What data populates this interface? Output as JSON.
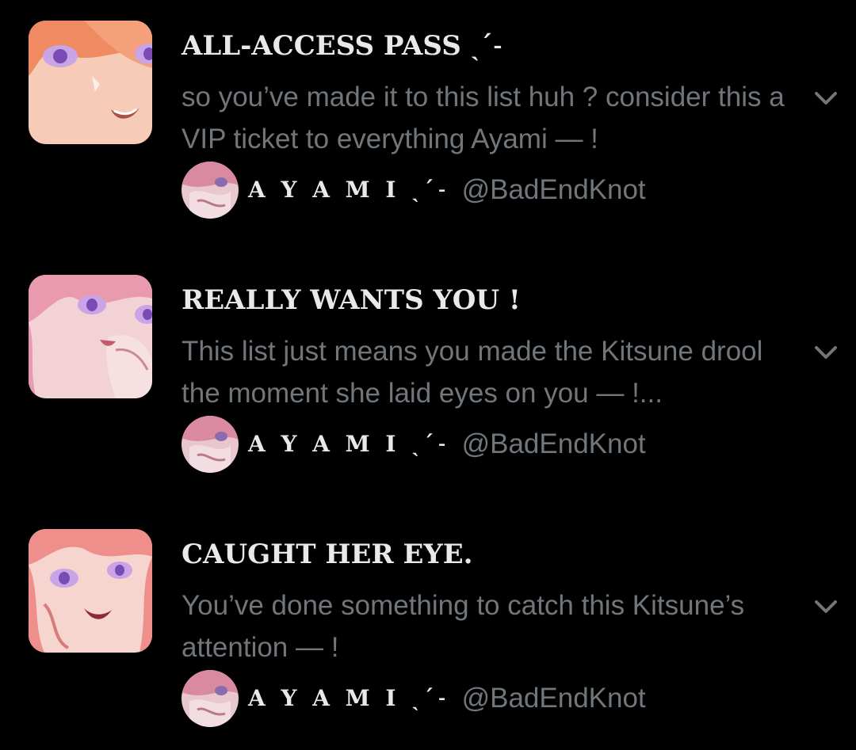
{
  "lists": [
    {
      "title": "ALL-ACCESS PASS ˎˊ˗",
      "description": "so you’ve made it to this list huh ? consider this a VIP ticket to everything Ayami — !",
      "owner_name": "A Y A M I ˎˊ˗",
      "owner_handle": "@BadEndKnot"
    },
    {
      "title": "REALLY WANTS YOU !",
      "description": "This list just means you made the Kitsune drool the moment she laid eyes on you — !...",
      "owner_name": "A Y A M I ˎˊ˗",
      "owner_handle": "@BadEndKnot"
    },
    {
      "title": "CAUGHT HER EYE.",
      "description": "You’ve done something to catch this Kitsune’s attention — !",
      "owner_name": "A Y A M I ˎˊ˗",
      "owner_handle": "@BadEndKnot"
    }
  ],
  "colors": {
    "background": "#000000",
    "primary_text": "#e7e9ea",
    "secondary_text": "#71767b"
  },
  "icons": {
    "expand": "chevron-down-icon"
  }
}
